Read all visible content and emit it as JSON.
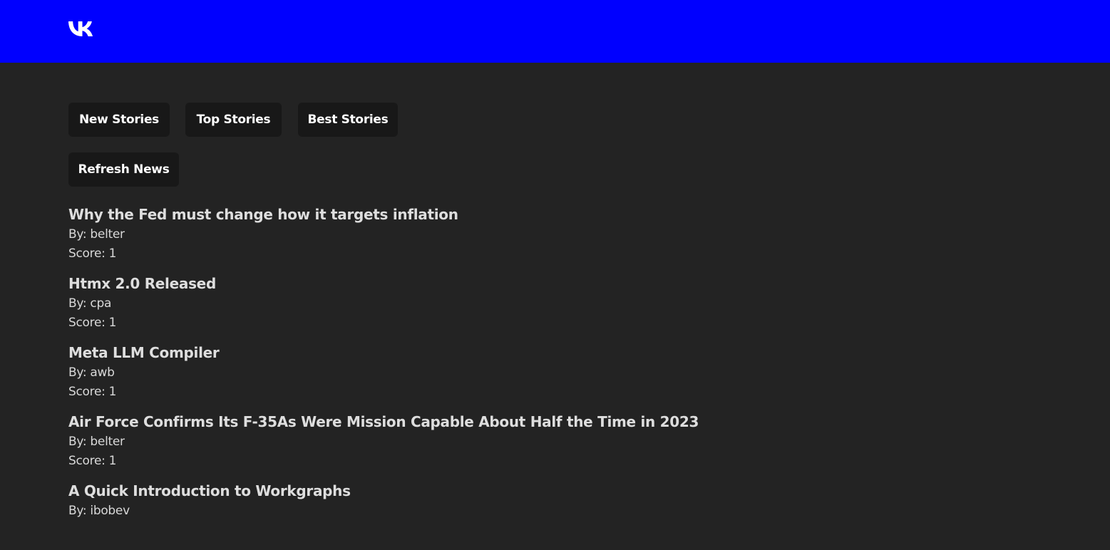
{
  "header": {
    "logo_icon": "vk-logo-icon",
    "background_color": "#0000ff"
  },
  "nav": {
    "new_stories": "New Stories",
    "top_stories": "Top Stories",
    "best_stories": "Best Stories",
    "refresh_news": "Refresh News"
  },
  "stories": [
    {
      "title": "Why the Fed must change how it targets inflation",
      "by": "By: belter",
      "score": "Score: 1"
    },
    {
      "title": "Htmx 2.0 Released",
      "by": "By: cpa",
      "score": "Score: 1"
    },
    {
      "title": "Meta LLM Compiler",
      "by": "By: awb",
      "score": "Score: 1"
    },
    {
      "title": "Air Force Confirms Its F-35As Were Mission Capable About Half the Time in 2023",
      "by": "By: belter",
      "score": "Score: 1"
    },
    {
      "title": "A Quick Introduction to Workgraphs",
      "by": "By: ibobev",
      "score": ""
    }
  ]
}
